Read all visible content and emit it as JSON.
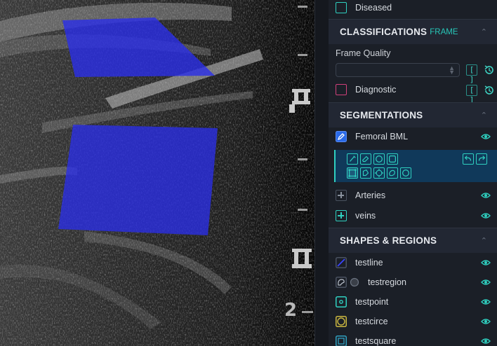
{
  "viewport": {
    "scale_labels": [
      "2"
    ],
    "overlay_color": "#2a2ee8"
  },
  "panel": {
    "top_item": {
      "label": "Diseased"
    },
    "classifications": {
      "title": "CLASSIFICATIONS",
      "subtitle": "FRAME",
      "frame_quality_label": "Frame Quality",
      "frame_quality_value": "",
      "bracket_label": "[ ]",
      "diagnostic_label": "Diagnostic"
    },
    "segmentations": {
      "title": "SEGMENTATIONS",
      "active_item": "Femoral BML",
      "items": [
        "Arteries",
        "veins"
      ]
    },
    "shapes": {
      "title": "SHAPES & REGIONS",
      "items": [
        "testline",
        "testregion",
        "testpoint",
        "testcirce",
        "testsquare"
      ]
    },
    "colors": {
      "accent": "#2fd0c0",
      "diagnostic": "#d0407a",
      "panel_bg": "#1b1f27",
      "tool_bg": "#10395a"
    }
  }
}
